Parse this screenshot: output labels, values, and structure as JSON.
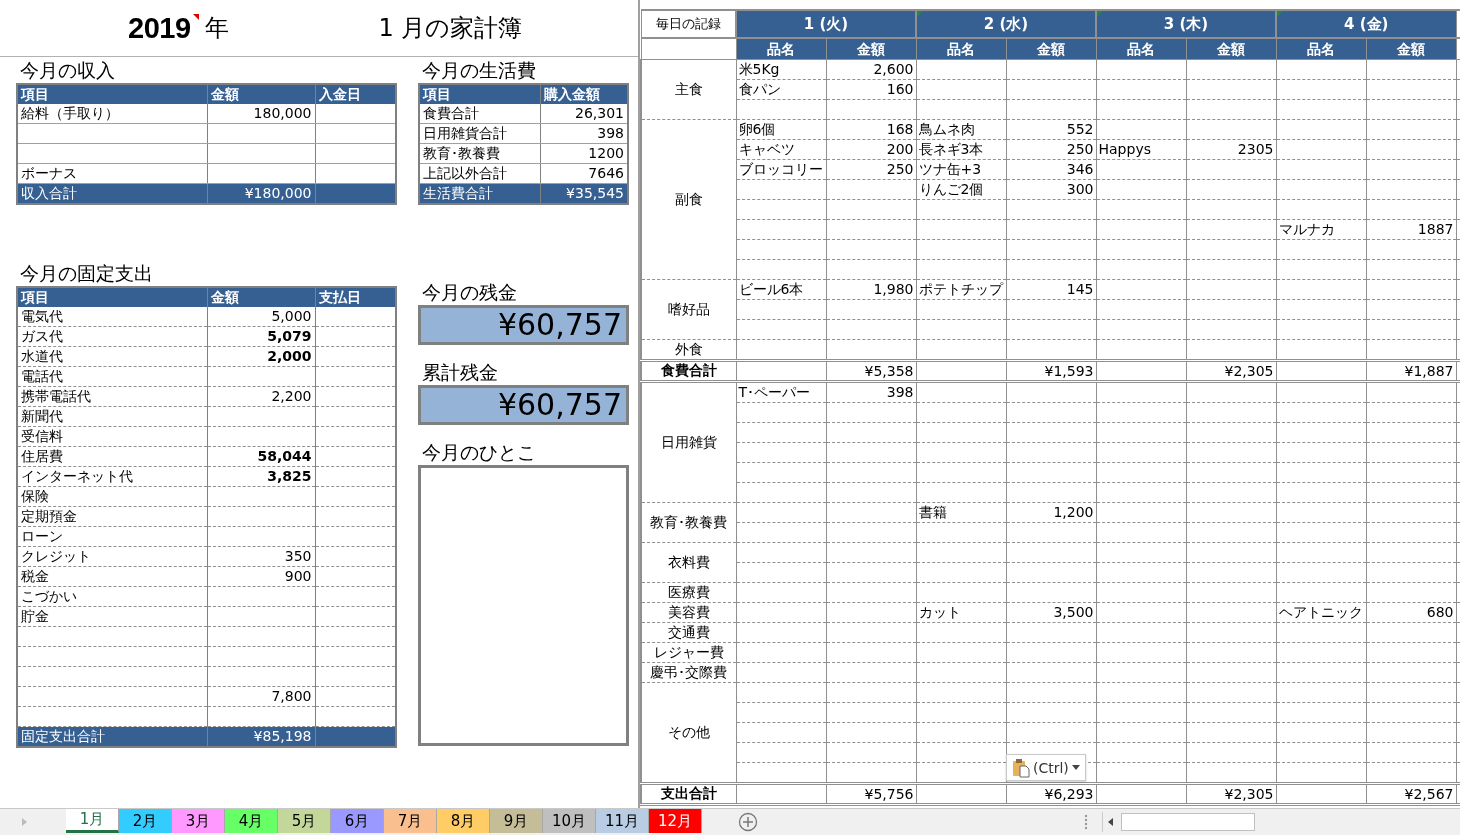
{
  "title": {
    "year": "2019",
    "year_has_comment": true,
    "year_unit": "年",
    "month_title": "1 月の家計簿"
  },
  "income": {
    "heading": "今月の収入",
    "columns": [
      "項目",
      "金額",
      "入金日"
    ],
    "rows": [
      {
        "item": "給料（手取り）",
        "amount": "180,000"
      },
      {},
      {},
      {
        "item": "ボーナス"
      }
    ],
    "total": {
      "label": "収入合計",
      "amount": "¥180,000"
    }
  },
  "living": {
    "heading": "今月の生活費",
    "columns": [
      "項目",
      "購入金額"
    ],
    "rows": [
      {
        "item": "食費合計",
        "amount": "26,301"
      },
      {
        "item": "日用雑貨合計",
        "amount": "398"
      },
      {
        "item": "教育･教養費",
        "amount": "1200"
      },
      {
        "item": "上記以外合計",
        "amount": "7646"
      }
    ],
    "total": {
      "label": "生活費合計",
      "amount": "¥35,545"
    }
  },
  "fixed": {
    "heading": "今月の固定支出",
    "columns": [
      "項目",
      "金額",
      "支払日"
    ],
    "rows": [
      {
        "item": "電気代",
        "amount": "5,000",
        "bold": false
      },
      {
        "item": "ガス代",
        "amount": "5,079",
        "bold": true
      },
      {
        "item": "水道代",
        "amount": "2,000",
        "bold": true
      },
      {
        "item": "電話代"
      },
      {
        "item": "携帯電話代",
        "amount": "2,200",
        "bold": false
      },
      {
        "item": "新聞代"
      },
      {
        "item": "受信料"
      },
      {
        "item": "住居費",
        "amount": "58,044",
        "bold": true
      },
      {
        "item": "インターネット代",
        "amount": "3,825",
        "bold": true
      },
      {
        "item": "保険"
      },
      {
        "item": "定期預金"
      },
      {
        "item": "ローン"
      },
      {
        "item": "クレジット",
        "amount": "350",
        "bold": false
      },
      {
        "item": "税金",
        "amount": "900",
        "bold": false
      },
      {
        "item": "こづかい"
      },
      {
        "item": "貯金"
      },
      {},
      {},
      {},
      {
        "amount": "7,800",
        "bold": false
      },
      {}
    ],
    "total": {
      "label": "固定支出合計",
      "amount": "¥85,198"
    }
  },
  "balance": {
    "heading": "今月の残金",
    "amount": "¥60,757"
  },
  "cumulative": {
    "heading": "累計残金",
    "amount": "¥60,757"
  },
  "memo": {
    "heading": "今月のひとこ"
  },
  "daily": {
    "corner": "毎日の記録",
    "days": [
      {
        "label": "1 (火)",
        "has_comment": false,
        "item_header": "品名",
        "amount_header": "金額"
      },
      {
        "label": "2 (水)",
        "has_comment": true,
        "item_header": "品名",
        "amount_header": "金額"
      },
      {
        "label": "3 (木)",
        "has_comment": true,
        "item_header": "品名",
        "amount_header": "金額"
      },
      {
        "label": "4 (金)",
        "has_comment": true,
        "item_header": "品名",
        "amount_header": "金額"
      }
    ],
    "sections": [
      {
        "kind": "category",
        "name": "主食",
        "rows": [
          [
            {
              "item": "米5Kg",
              "amount": "2,600"
            },
            null,
            null,
            null
          ],
          [
            {
              "item": "食パン",
              "amount": "160"
            },
            null,
            null,
            null
          ],
          [
            null,
            null,
            null,
            null
          ]
        ]
      },
      {
        "kind": "category",
        "name": "副食",
        "rows": [
          [
            {
              "item": "卵6個",
              "amount": "168"
            },
            {
              "item": "鳥ムネ肉",
              "amount": "552"
            },
            null,
            null
          ],
          [
            {
              "item": "キャベツ",
              "amount": "200"
            },
            {
              "item": "長ネギ3本",
              "amount": "250"
            },
            {
              "item": "Happys",
              "amount": "2305"
            },
            null
          ],
          [
            {
              "item": "ブロッコリー",
              "amount": "250"
            },
            {
              "item": "ツナ缶+3",
              "amount": "346"
            },
            null,
            null
          ],
          [
            null,
            {
              "item": "りんご2個",
              "amount": "300"
            },
            null,
            null
          ],
          [
            null,
            null,
            null,
            null
          ],
          [
            null,
            null,
            null,
            {
              "item": "マルナカ",
              "amount": "1887"
            }
          ],
          [
            null,
            null,
            null,
            null
          ],
          [
            null,
            null,
            null,
            null
          ]
        ]
      },
      {
        "kind": "category",
        "name": "嗜好品",
        "rows": [
          [
            {
              "item": "ビール6本",
              "amount": "1,980"
            },
            {
              "item": "ポテトチップ",
              "amount": "145"
            },
            null,
            null
          ],
          [
            null,
            null,
            null,
            null
          ],
          [
            null,
            null,
            null,
            null
          ]
        ]
      },
      {
        "kind": "category",
        "name": "外食",
        "rows": [
          [
            null,
            null,
            null,
            null
          ]
        ]
      },
      {
        "kind": "total",
        "name": "食費合計",
        "amounts": [
          "¥5,358",
          "¥1,593",
          "¥2,305",
          "¥1,887"
        ]
      },
      {
        "kind": "category",
        "name": "日用雑貨",
        "rows": [
          [
            {
              "item": "T･ペーパー",
              "amount": "398"
            },
            null,
            null,
            null
          ],
          [
            null,
            null,
            null,
            null
          ],
          [
            null,
            null,
            null,
            null
          ],
          [
            null,
            null,
            null,
            null
          ],
          [
            null,
            null,
            null,
            null
          ],
          [
            null,
            null,
            null,
            null
          ]
        ]
      },
      {
        "kind": "category",
        "name": "教育･教養費",
        "rows": [
          [
            null,
            {
              "item": "書籍",
              "amount": "1,200"
            },
            null,
            null
          ],
          [
            null,
            null,
            null,
            null
          ]
        ]
      },
      {
        "kind": "category",
        "name": "衣料費",
        "rows": [
          [
            null,
            null,
            null,
            null
          ],
          [
            null,
            null,
            null,
            null
          ]
        ]
      },
      {
        "kind": "category",
        "name": "医療費",
        "rows": [
          [
            null,
            null,
            null,
            null
          ]
        ]
      },
      {
        "kind": "category",
        "name": "美容費",
        "rows": [
          [
            null,
            {
              "item": "カット",
              "amount": "3,500"
            },
            null,
            {
              "item": "ヘアトニック",
              "amount": "680"
            }
          ]
        ]
      },
      {
        "kind": "category",
        "name": "交通費",
        "rows": [
          [
            null,
            null,
            null,
            null
          ]
        ]
      },
      {
        "kind": "category",
        "name": "レジャー費",
        "rows": [
          [
            null,
            null,
            null,
            null
          ]
        ]
      },
      {
        "kind": "category",
        "name": "慶弔･交際費",
        "rows": [
          [
            null,
            null,
            null,
            null
          ]
        ]
      },
      {
        "kind": "category",
        "name": "その他",
        "rows": [
          [
            null,
            null,
            null,
            null
          ],
          [
            null,
            null,
            null,
            null
          ],
          [
            null,
            null,
            null,
            null
          ],
          [
            null,
            null,
            null,
            null
          ],
          [
            null,
            null,
            null,
            null
          ]
        ]
      },
      {
        "kind": "total",
        "name": "支出合計",
        "amounts": [
          "¥5,756",
          "¥6,293",
          "¥2,305",
          "¥2,567"
        ]
      }
    ]
  },
  "paste_options": {
    "label": "(Ctrl)"
  },
  "sheet_tabs": [
    {
      "label": "1月",
      "selected": true
    },
    {
      "label": "2月",
      "selected": false,
      "color": "#33ccff"
    },
    {
      "label": "3月",
      "selected": false,
      "color": "#ff99ff"
    },
    {
      "label": "4月",
      "selected": false,
      "color": "#66ff66"
    },
    {
      "label": "5月",
      "selected": false,
      "color": "#c4d79b"
    },
    {
      "label": "6月",
      "selected": false,
      "color": "#9999ff"
    },
    {
      "label": "7月",
      "selected": false,
      "color": "#fabf8f"
    },
    {
      "label": "8月",
      "selected": false,
      "color": "#ffcc66"
    },
    {
      "label": "9月",
      "selected": false,
      "color": "#c4bd97"
    },
    {
      "label": "10月",
      "selected": false,
      "color": "#bfbfbf"
    },
    {
      "label": "11月",
      "selected": false,
      "color": "#b8cce4"
    },
    {
      "label": "12月",
      "selected": false,
      "color": "#ff0000"
    }
  ]
}
